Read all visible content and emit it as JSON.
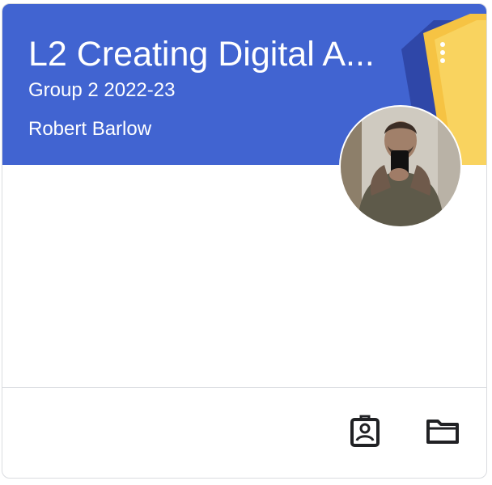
{
  "course": {
    "title": "L2 Creating Digital A...",
    "section": "Group 2 2022-23",
    "teacher": "Robert Barlow"
  },
  "icons": {
    "more": "more-vert-icon",
    "assignment": "assignment-ind-icon",
    "folder": "folder-icon"
  },
  "colors": {
    "header": "#4164d1",
    "notebook": "#f6c343",
    "notebook_spine": "#2f47a8",
    "earbuds": "#2a3f9e"
  }
}
